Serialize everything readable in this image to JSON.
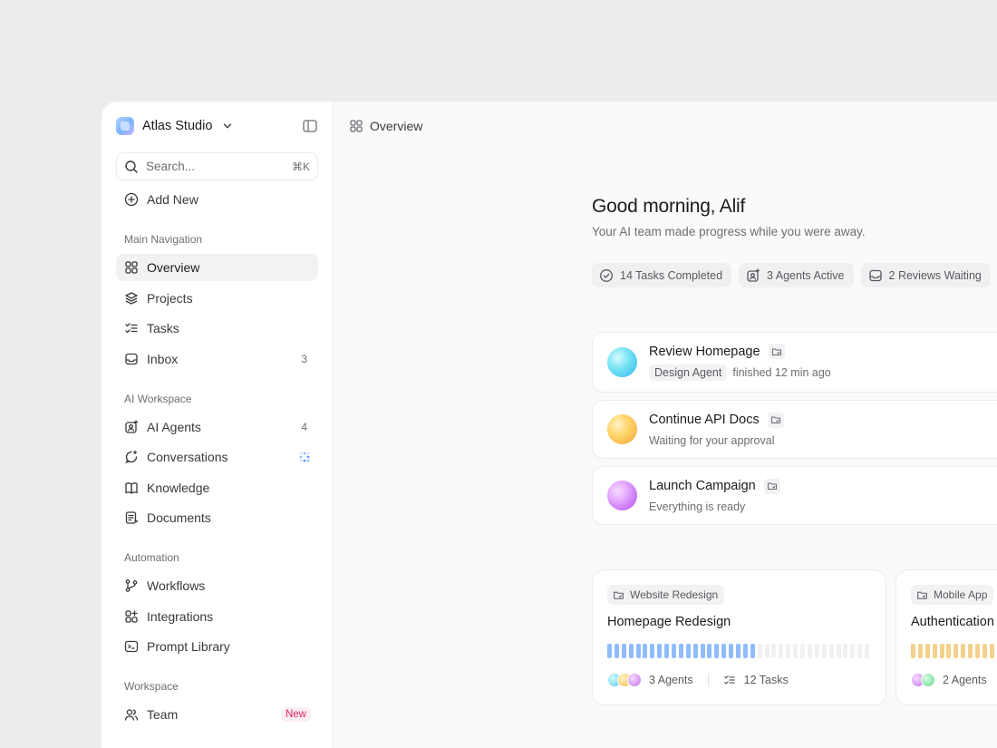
{
  "sidebar": {
    "brand": "Atlas Studio",
    "search_placeholder": "Search...",
    "search_shortcut": "⌘K",
    "add_new": "Add New",
    "sections": {
      "main": "Main Navigation",
      "ai": "AI Workspace",
      "automation": "Automation",
      "workspace": "Workspace"
    },
    "items": {
      "overview": "Overview",
      "projects": "Projects",
      "tasks": "Tasks",
      "inbox": "Inbox",
      "inbox_count": "3",
      "ai_agents": "AI Agents",
      "ai_agents_count": "4",
      "conversations": "Conversations",
      "knowledge": "Knowledge",
      "documents": "Documents",
      "workflows": "Workflows",
      "integrations": "Integrations",
      "prompt_library": "Prompt Library",
      "team": "Team",
      "team_badge": "New"
    }
  },
  "topbar": {
    "breadcrumb": "Overview"
  },
  "greeting": {
    "title": "Good morning, Alif",
    "subtitle": "Your AI team made progress while you were away."
  },
  "chips": [
    {
      "label": "14 Tasks Completed",
      "icon": "check-circle-icon"
    },
    {
      "label": "3 Agents Active",
      "icon": "agent-sparkle-icon"
    },
    {
      "label": "2 Reviews Waiting",
      "icon": "inbox-icon"
    }
  ],
  "tasks": [
    {
      "title": "Review Homepage",
      "agent": "Design Agent",
      "status": "finished 12 min ago",
      "orb": "cyan"
    },
    {
      "title": "Continue API Docs",
      "status": "Waiting for your approval",
      "orb": "gold"
    },
    {
      "title": "Launch Campaign",
      "status": "Everything is ready",
      "orb": "violet"
    }
  ],
  "projects": [
    {
      "tag": "Website Redesign",
      "title": "Homepage Redesign",
      "agents": "3 Agents",
      "tasks": "12 Tasks",
      "progress": 0.58,
      "color": "#8fbcff"
    },
    {
      "tag": "Mobile App",
      "title": "Authentication System",
      "agents": "2 Agents",
      "progress": 0.62,
      "color": "#f2d18a"
    }
  ],
  "colors": {
    "accent": "#8fbcff",
    "badge_new": "#e0245e"
  }
}
